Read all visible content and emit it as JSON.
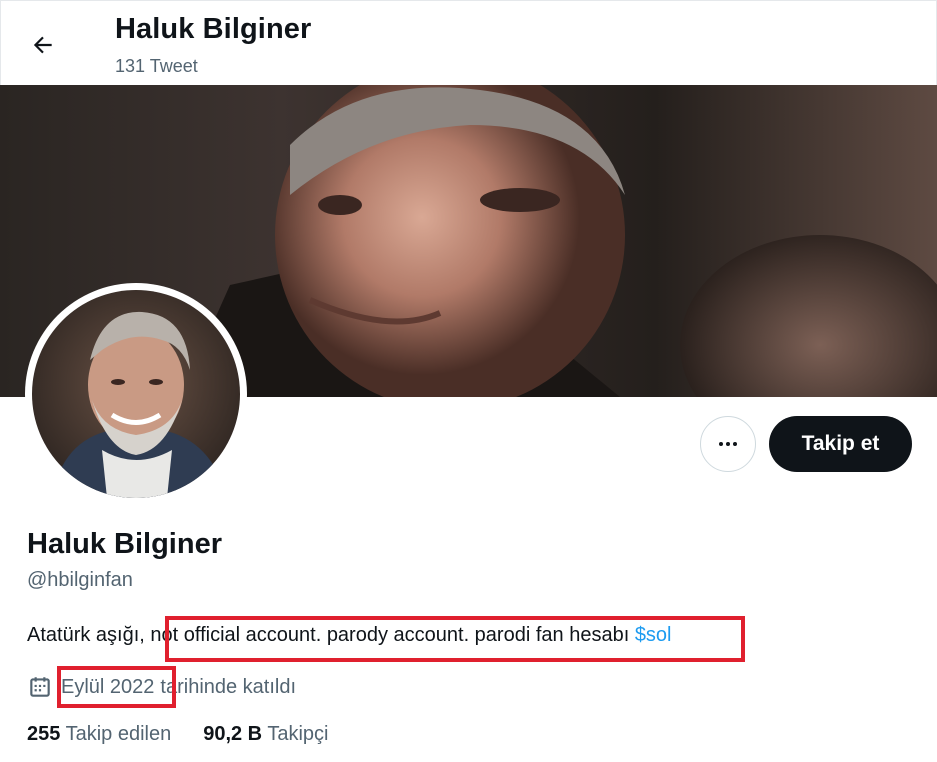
{
  "header": {
    "title": "Haluk Bilginer",
    "tweet_count": "131 Tweet"
  },
  "profile": {
    "name": "Haluk Bilginer",
    "handle": "@hbilginfan",
    "bio_prefix": "Atatürk aşığı,",
    "bio_highlight": "not official account. parody account. parodi fan hesabı",
    "bio_link": "$sol",
    "joined_highlight": "Eylül 2022",
    "joined_suffix": "tarihinde katıldı"
  },
  "actions": {
    "more_icon": "more-horizontal-icon",
    "follow_label": "Takip et"
  },
  "stats": {
    "following_count": "255",
    "following_label": "Takip edilen",
    "followers_count": "90,2 B",
    "followers_label": "Takipçi"
  },
  "colors": {
    "highlight_box": "#e0202e",
    "link": "#1d9bf0",
    "follow_button": "#0f1419",
    "secondary_text": "#536471"
  }
}
